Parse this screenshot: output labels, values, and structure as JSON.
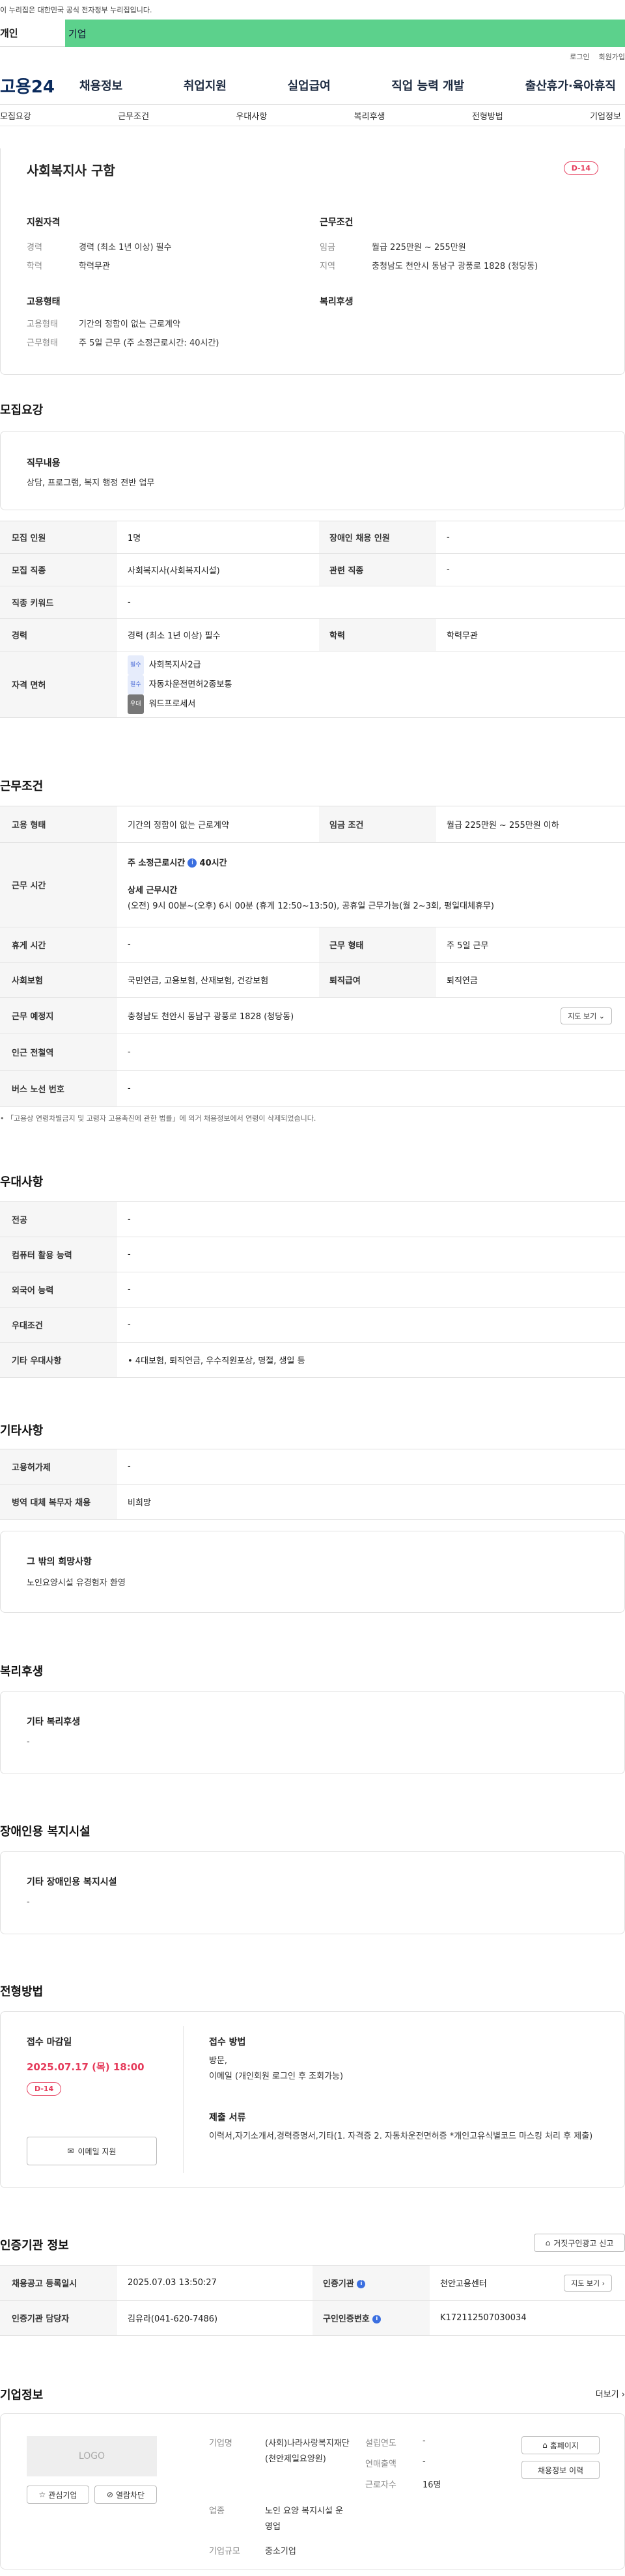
{
  "gov_banner": "이 누리집은 대한민국 공식 전자정부 누리집입니다.",
  "user_tabs": [
    "개인",
    "기업"
  ],
  "util_links": [
    "로그인",
    "회원가입"
  ],
  "logo": "고용24",
  "gnb": [
    "채용정보",
    "취업지원",
    "실업급여",
    "직업 능력 개발",
    "출산휴가·육아휴직"
  ],
  "subnav": [
    "모집요강",
    "근무조건",
    "우대사항",
    "복리후생",
    "전형방법",
    "기업정보"
  ],
  "summary": {
    "title": "사회복지사 구함",
    "dday": "D-14",
    "qual_title": "지원자격",
    "qual": [
      {
        "k": "경력",
        "v": "경력 (최소 1년 이상) 필수"
      },
      {
        "k": "학력",
        "v": "학력무관"
      }
    ],
    "cond_title": "근무조건",
    "cond": [
      {
        "k": "임금",
        "v": "월급 225만원 ~ 255만원"
      },
      {
        "k": "지역",
        "v": "충청남도 천안시 동남구 광풍로 1828 (청당동)"
      }
    ],
    "emp_title": "고용형태",
    "emp": [
      {
        "k": "고용형태",
        "v": "기간의 정함이 없는 근로계약"
      },
      {
        "k": "근무형태",
        "v": "주 5일 근무 (주 소정근로시간: 40시간)"
      }
    ],
    "welfare_title": "복리후생"
  },
  "recruit": {
    "heading": "모집요강",
    "duty_label": "직무내용",
    "duty": "상담, 프로그램, 복지 행정 전반 업무",
    "rows": [
      [
        "모집 인원",
        "1명",
        "장애인 채용 인원",
        "-"
      ],
      [
        "모집 직종",
        "사회복지사(사회복지시설)",
        "관련 직종",
        "-"
      ],
      [
        "직종 키워드",
        "-"
      ],
      [
        "경력",
        "경력 (최소 1년 이상) 필수",
        "학력",
        "학력무관"
      ]
    ],
    "license_label": "자격 면허",
    "licenses": [
      {
        "badge": "필수",
        "name": "사회복지사2급"
      },
      {
        "badge": "필수",
        "name": "자동차운전면허2종보통"
      },
      {
        "badge": "우대",
        "name": "워드프로세서"
      }
    ]
  },
  "conditions": {
    "heading": "근무조건",
    "r1": [
      "고용 형태",
      "기간의 정함이 없는 근로계약",
      "임금 조건",
      "월급 225만원 ~ 255만원 이하"
    ],
    "hours_label": "근무 시간",
    "hours_main": "주 소정근로시간",
    "hours_value": "40시간",
    "hours_detail_title": "상세 근무시간",
    "hours_detail": "(오전) 9시 00분~(오후) 6시 00분 (휴게 12:50~13:50), 공휴일 근무가능(월 2~3회, 평일대체휴무)",
    "r3": [
      "휴게 시간",
      "-",
      "근무 형태",
      "주 5일 근무"
    ],
    "r4": [
      "사회보험",
      "국민연금, 고용보험, 산재보험, 건강보험",
      "퇴직급여",
      "퇴직연금"
    ],
    "r5": [
      "근무 예정지",
      "충청남도 천안시 동남구 광풍로 1828 (청당동)"
    ],
    "map_btn": "지도 보기",
    "r6": [
      "인근 전철역",
      "-"
    ],
    "r7": [
      "버스 노선 번호",
      "-"
    ],
    "note": "「고용상 연령차별금지 및 고령자 고용촉진에 관한 법률」에 의거 채용정보에서 연령이 삭제되었습니다."
  },
  "preferences": {
    "heading": "우대사항",
    "rows": [
      [
        "전공",
        "-"
      ],
      [
        "컴퓨터 활용 능력",
        "-"
      ],
      [
        "외국어 능력",
        "-"
      ],
      [
        "우대조건",
        "-"
      ],
      [
        "기타 우대사항",
        "• 4대보험, 퇴직연금, 우수직원포상, 명절, 생일 등"
      ]
    ]
  },
  "other": {
    "heading": "기타사항",
    "rows": [
      [
        "고용허가제",
        "-"
      ],
      [
        "병역 대체 복무자 채용",
        "비희망"
      ]
    ],
    "wish_label": "그 밖의 희망사항",
    "wish": "노인요양시설  유경험자 환영"
  },
  "welfare": {
    "heading": "복리후생",
    "label": "기타 복리후생",
    "value": "-"
  },
  "disability": {
    "heading": "장애인용 복지시설",
    "label": "기타 장애인용 복지시설",
    "value": "-"
  },
  "selection": {
    "heading": "전형방법",
    "deadline_label": "접수 마감일",
    "deadline": "2025.07.17 (목) 18:00",
    "dday": "D-14",
    "email_btn": "이메일 지원",
    "method_label": "접수 방법",
    "method": "방문,\n이메일 (개인회원 로그인 후 조회가능)",
    "docs_label": "제출 서류",
    "docs": "이력서,자기소개서,경력증명서,기타(1. 자격증 2. 자동차운전면허증 *개인고유식별코드 마스킹 처리 후 제출)"
  },
  "agency": {
    "heading": "인증기관 정보",
    "report_btn": "거짓구인광고 신고",
    "r1": [
      "채용공고 등록일시",
      "2025.07.03 13:50:27",
      "인증기관",
      "천안고용센터"
    ],
    "map_btn": "지도 보기",
    "r2": [
      "인증기관 담당자",
      "김유라(041-620-7486)",
      "구인인증번호",
      "K172112507030034"
    ]
  },
  "company": {
    "heading": "기업정보",
    "more": "더보기",
    "logo": "LOGO",
    "fav_btn": "관심기업",
    "block_btn": "열람차단",
    "name_label": "기업명",
    "name": "(사회)나라사랑복지재단(천안제일요양원)",
    "industry_label": "업종",
    "industry": "노인 요양 복지시설 운영업",
    "size_label": "기업규모",
    "size": "중소기업",
    "founded_label": "설립연도",
    "founded": "-",
    "revenue_label": "연매출액",
    "revenue": "-",
    "staff_label": "근로자수",
    "staff": "16명",
    "home_btn": "홈페이지",
    "history_btn": "채용정보 이력"
  }
}
